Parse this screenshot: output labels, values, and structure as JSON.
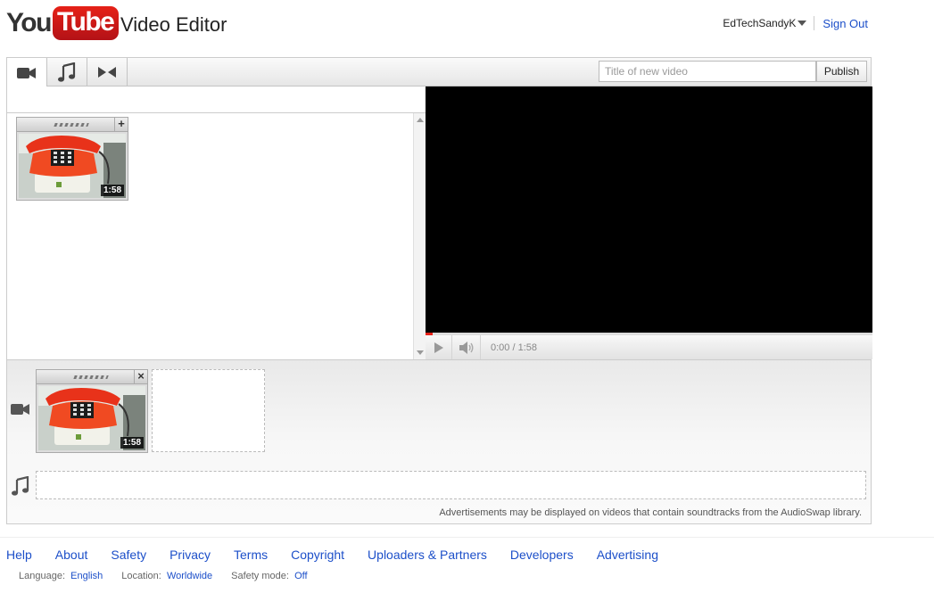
{
  "header": {
    "logo_you": "You",
    "logo_tube": "Tube",
    "title": "Video Editor",
    "username": "EdTechSandyK",
    "sign_out": "Sign Out"
  },
  "toolbar": {
    "tabs": [
      {
        "name": "video",
        "icon": "video-camera-icon"
      },
      {
        "name": "audio",
        "icon": "music-note-icon"
      },
      {
        "name": "transitions",
        "icon": "bowtie-icon"
      }
    ],
    "title_placeholder": "Title of new video",
    "title_value": "",
    "publish_label": "Publish"
  },
  "library": {
    "clips": [
      {
        "duration": "1:58",
        "thumbnail": "red-telephone-icon"
      }
    ]
  },
  "player": {
    "time": "0:00 / 1:58",
    "progress": 0
  },
  "timeline": {
    "clips": [
      {
        "duration": "1:58",
        "thumbnail": "red-telephone-icon"
      }
    ],
    "disclaimer": "Advertisements may be displayed on videos that contain soundtracks from the AudioSwap library."
  },
  "footer": {
    "links": [
      "Help",
      "About",
      "Safety",
      "Privacy",
      "Terms",
      "Copyright",
      "Uploaders & Partners",
      "Developers",
      "Advertising"
    ],
    "language_label": "Language:",
    "language_value": "English",
    "location_label": "Location:",
    "location_value": "Worldwide",
    "safety_label": "Safety mode:",
    "safety_value": "Off"
  },
  "colors": {
    "brand_red": "#e62117",
    "link_blue": "#1c4fc9"
  }
}
